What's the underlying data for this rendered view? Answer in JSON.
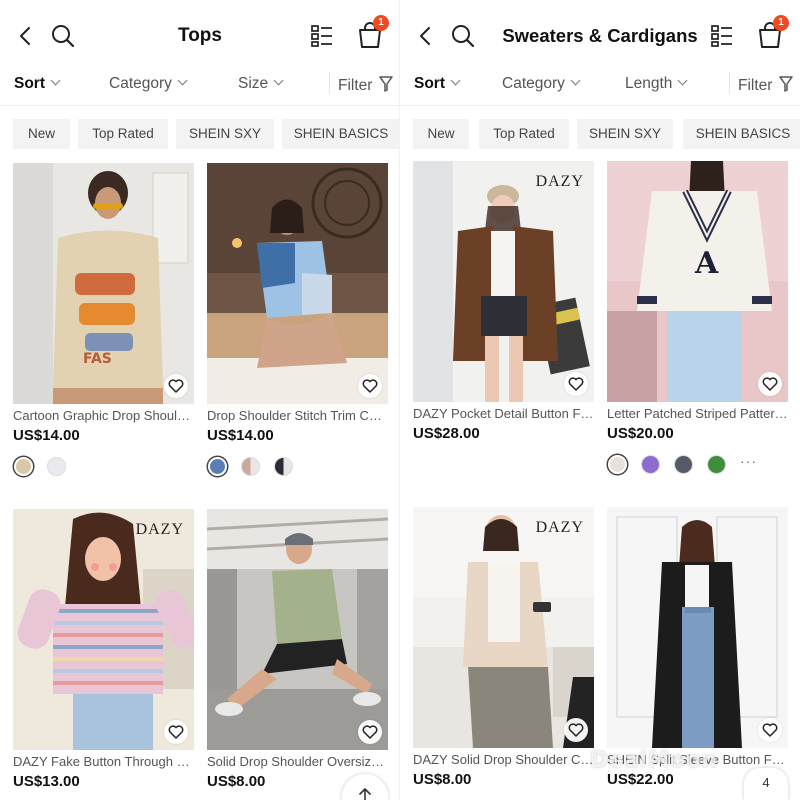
{
  "left": {
    "title": "Tops",
    "cart_badge": "1",
    "filters": {
      "sort": "Sort",
      "category": "Category",
      "size": "Size",
      "filter": "Filter"
    },
    "chips": [
      "New",
      "Top Rated",
      "SHEIN SXY",
      "SHEIN BASICS"
    ],
    "products": [
      {
        "title": "Cartoon Graphic Drop Shoulder Tee",
        "price": "US$14.00",
        "swatches": [
          "#d8c8a8",
          "#e9e9ee"
        ]
      },
      {
        "title": "Drop Shoulder Stitch Trim Colorblock Tee",
        "price": "US$14.00",
        "swatches": [
          "#5b7fb5",
          "#c9a9a0",
          "#2a2d36"
        ]
      },
      {
        "title": "DAZY Fake Button Through Striped Top",
        "price": "US$13.00",
        "brand": "DAZY"
      },
      {
        "title": "Solid Drop Shoulder Oversized Tee",
        "price": "US$8.00"
      }
    ]
  },
  "right": {
    "title": "Sweaters & Cardigans",
    "cart_badge": "1",
    "filters": {
      "sort": "Sort",
      "category": "Category",
      "length": "Length",
      "filter": "Filter"
    },
    "chips": [
      "New",
      "Top Rated",
      "SHEIN SXY",
      "SHEIN BASICS"
    ],
    "products": [
      {
        "title": "DAZY Pocket Detail Button Front Cardigan",
        "price": "US$28.00",
        "brand": "DAZY"
      },
      {
        "title": "Letter Patched Striped Pattern Sweater",
        "price": "US$20.00",
        "swatches": [
          "#e6e2da",
          "#8e6bd1",
          "#555a66",
          "#3f8f3a"
        ],
        "more": "···"
      },
      {
        "title": "DAZY Solid Drop Shoulder Cardigan",
        "price": "US$8.00",
        "brand": "DAZY"
      },
      {
        "title": "SHEIN Split Sleeve Button Front Cardigan",
        "price": "US$22.00"
      }
    ]
  },
  "page_number": "4",
  "watermark": "DealMoon",
  "colors": {
    "badge": "#f04a23",
    "chip_bg": "#f3f3f3"
  },
  "icons": [
    "back-arrow-icon",
    "search-icon",
    "grid-view-icon",
    "shopping-bag-icon",
    "filter-funnel-icon",
    "heart-icon",
    "arrow-up-icon"
  ]
}
